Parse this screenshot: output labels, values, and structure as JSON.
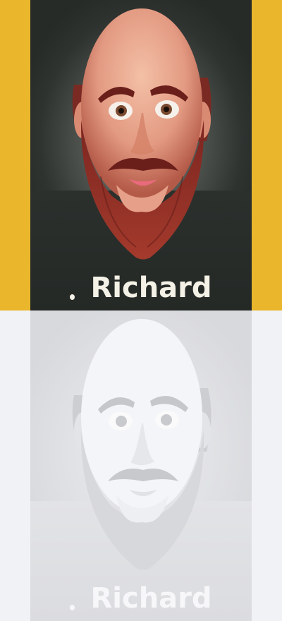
{
  "image": {
    "subject": "cartoon-face-card",
    "panels": [
      {
        "variant": "color",
        "name": "Richard"
      },
      {
        "variant": "washed-out",
        "name": "Richard"
      }
    ]
  },
  "colors": {
    "background_top": "#e9b62c",
    "background_bottom": "#f1f2f6",
    "card_dark": "#2e3330",
    "skin": "#e8a48c",
    "beard": "#8a2c22",
    "name_text": "#f4f1e6"
  }
}
